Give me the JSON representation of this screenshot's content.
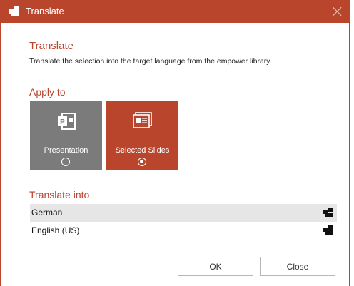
{
  "window": {
    "title": "Translate",
    "icon": "empower-logo-icon",
    "close_icon": "close-icon"
  },
  "header": {
    "title": "Translate",
    "description": "Translate the selection into the target language from the empower library."
  },
  "apply_to": {
    "label": "Apply to",
    "options": [
      {
        "label": "Presentation",
        "icon": "powerpoint-icon",
        "selected": false
      },
      {
        "label": "Selected Slides",
        "icon": "slides-icon",
        "selected": true
      }
    ]
  },
  "translate_into": {
    "label": "Translate into",
    "languages": [
      {
        "name": "German",
        "icon": "empower-logo-icon"
      },
      {
        "name": "English (US)",
        "icon": "empower-logo-icon"
      }
    ]
  },
  "buttons": {
    "ok": "OK",
    "close": "Close"
  },
  "colors": {
    "accent": "#b9452c",
    "tile_inactive": "#7b7b7b",
    "row_shade": "#e6e6e6"
  }
}
